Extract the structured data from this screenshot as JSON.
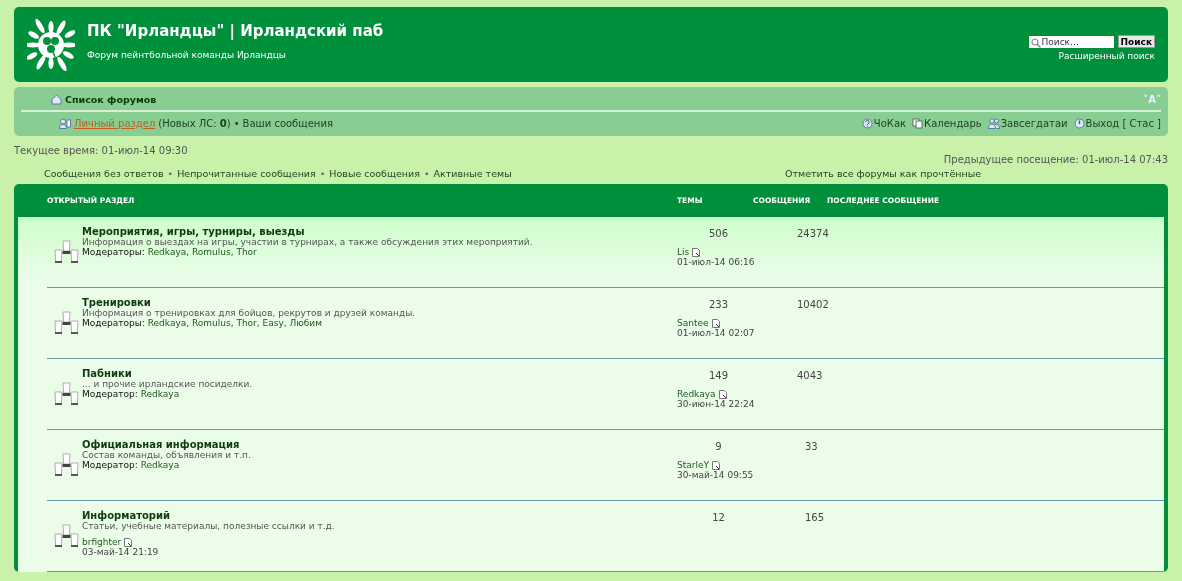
{
  "header": {
    "title": "ПК \"Ирландцы\" | Ирландский паб",
    "description": "Форум пейнтбольной команды Ирландцы",
    "search": {
      "placeholder": "Поиск…",
      "button": "Поиск"
    },
    "advanced_search": "Расширенный поиск"
  },
  "navbar": {
    "breadcrumb": "Список форумов",
    "font_size_toggle": "˅A˄",
    "user_line": [
      {
        "kind": "link",
        "label": "Личный раздел"
      },
      {
        "kind": "text",
        "label": "(Новых ЛС: **0**)"
      },
      {
        "kind": "sep",
        "label": "•"
      },
      {
        "kind": "plain-link",
        "label": "Ваши сообщения"
      }
    ],
    "links": [
      {
        "kind": "help",
        "label": "ЧоКак"
      },
      {
        "kind": "calendar",
        "label": "Календарь"
      },
      {
        "kind": "members",
        "label": "Завсегдатаи"
      },
      {
        "kind": "logout",
        "label": "Выход [ Стас ]"
      }
    ]
  },
  "current_time": "Текущее время: 01-июл-14 09:30",
  "last_visit": "Предыдущее посещение: 01-июл-14 07:43",
  "quick_links": [
    {
      "kind": "link",
      "label": "Сообщения без ответов"
    },
    {
      "kind": "sep",
      "label": "•"
    },
    {
      "kind": "link",
      "label": "Непрочитанные сообщения"
    },
    {
      "kind": "sep",
      "label": "•"
    },
    {
      "kind": "link",
      "label": "Новые сообщения"
    },
    {
      "kind": "sep",
      "label": "•"
    },
    {
      "kind": "link",
      "label": "Активные темы"
    }
  ],
  "mark_read": "Отметить все форумы как прочтённые",
  "table": {
    "columns": [
      "ОТКРЫТЫЙ РАЗДЕЛ",
      "ТЕМЫ",
      "СООБЩЕНИЯ",
      "ПОСЛЕДНЕЕ СООБЩЕНИЕ"
    ],
    "rows": [
      {
        "kind": "normal",
        "title": "Мероприятия, игры, турниры, выезды",
        "description": "Информация о выездах на игры, участии в турнирах, а также обсуждения этих мероприятий.",
        "moderators_label": "Модераторы:",
        "moderators": "Redkaya, Romulus, Thor",
        "topics": "506",
        "posts": "24374",
        "last_author": "Lis",
        "last_date": "01-июл-14 06:16"
      },
      {
        "kind": "normal",
        "title": "Тренировки",
        "description": "Информация о тренировках для бойцов, рекрутов и друзей команды.",
        "moderators_label": "Модераторы:",
        "moderators": "Redkaya, Romulus, Thor, Easy, Любим",
        "topics": "233",
        "posts": "10402",
        "last_author": "Santee",
        "last_date": "01-июл-14 02:07"
      },
      {
        "kind": "normal",
        "title": "Пабники",
        "description": "... и прочие ирландские посиделки.",
        "moderators_label": "Модератор:",
        "moderators": "Redkaya",
        "topics": "149",
        "posts": "4043",
        "last_author": "Redkaya",
        "last_date": "30-июн-14 22:24"
      },
      {
        "kind": "normal",
        "title": "Официальная информация",
        "description": "Состав команды, объявления и т.п.",
        "moderators_label": "Модератор:",
        "moderators": "Redkaya",
        "topics": "9",
        "posts": "33",
        "last_author": "StarleY",
        "last_date": "30-май-14 09:55"
      },
      {
        "kind": "inline",
        "title": "Информаторий",
        "description": "Статьи, учебные материалы, полезные ссылки и т.д.",
        "subforum_last_author": "brfighter",
        "subforum_last_date": "03-май-14 21:19",
        "topics": "12",
        "posts": "165"
      }
    ]
  }
}
